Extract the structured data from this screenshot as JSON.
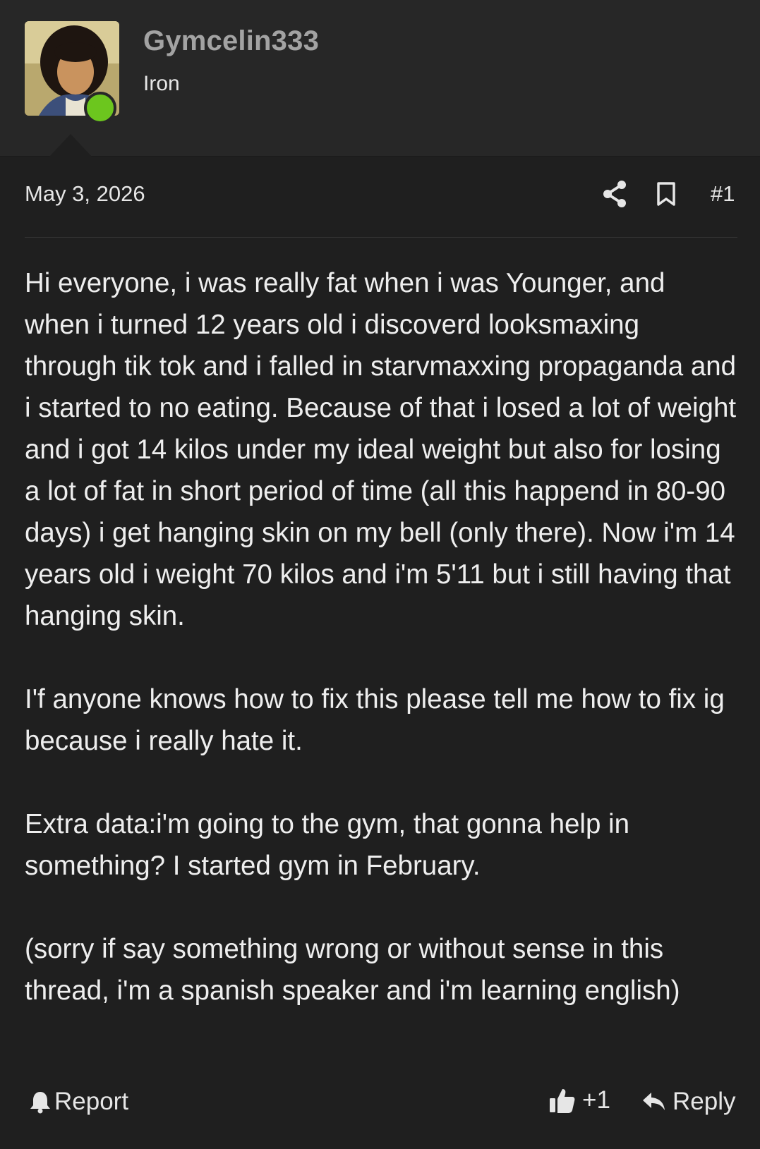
{
  "user": {
    "username": "Gymcelin333",
    "title": "Iron",
    "online_color": "#6cc61e"
  },
  "post": {
    "date": "May 3, 2026",
    "number": "#1",
    "icons": {
      "share": "share-icon",
      "bookmark": "bookmark-icon"
    },
    "paragraphs": [
      "Hi everyone, i was really fat when i was Younger, and when i turned 12 years old i discoverd looksmaxing through tik tok and i falled in starvmaxxing propaganda and i started to no eating. Because of that i losed a lot of weight and i got 14 kilos under my ideal weight but also for losing a lot of fat in short period of time (all this happend in 80-90 days) i get hanging skin on my bell (only there). Now i'm 14 years old i weight 70 kilos and i'm 5'11 but i still having that hanging skin.",
      "I'f anyone knows how to fix this please tell me how to fix ig because i really hate it.",
      "Extra data:i'm going to the gym, that gonna help in something? I started gym in February.",
      "(sorry if say something wrong or without sense in this thread, i'm a spanish speaker and i'm learning english)"
    ]
  },
  "actions": {
    "report_label": "Report",
    "like_count": "+1",
    "reply_label": "Reply"
  }
}
